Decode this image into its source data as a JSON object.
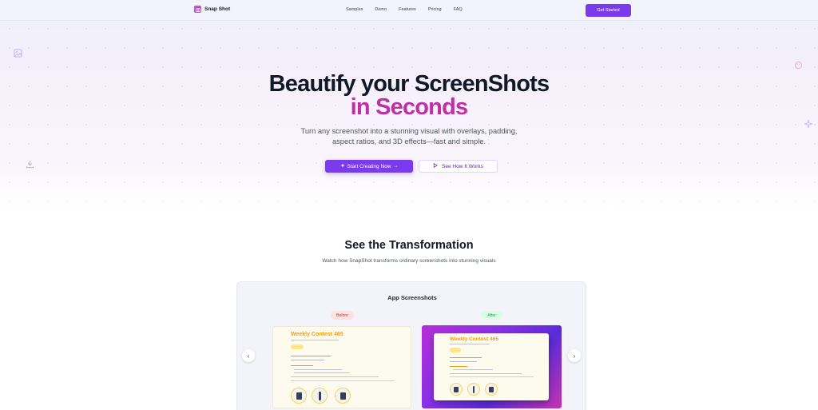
{
  "brand": {
    "name": "Snap Shot",
    "accent": "#7c3aed",
    "gradient_accent": "#c02fa6"
  },
  "nav": {
    "links": [
      "Samples",
      "Demo",
      "Features",
      "Pricing",
      "FAQ"
    ],
    "cta": "Get Started"
  },
  "hero": {
    "title_line1": "Beautify your ScreenShots",
    "title_line2": "in Seconds",
    "subtitle": "Turn any screenshot into a stunning visual with overlays, padding, aspect ratios, and 3D effects—fast and simple.",
    "primary_button": "Start Creating Now",
    "secondary_button": "See How It Works"
  },
  "transformation": {
    "title": "See the Transformation",
    "subtitle": "Watch how SnapShot transforms ordinary screenshots into stunning visuals",
    "card_title": "App Screenshots",
    "before_label": "Before",
    "after_label": "After",
    "sample_title": "Weekly Contest 465"
  },
  "icons": {
    "logo": "camera-icon",
    "primary_button": "sparkle-icon",
    "secondary_button": "play-icon",
    "carousel_prev": "chevron-left-icon",
    "carousel_next": "chevron-right-icon"
  }
}
